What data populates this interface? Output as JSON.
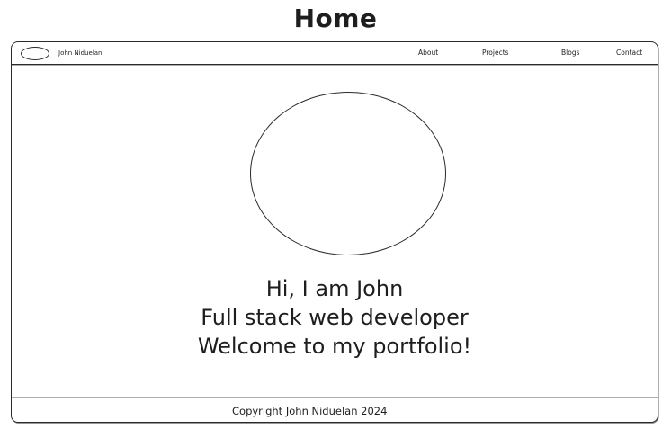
{
  "page": {
    "title": "Home"
  },
  "navbar": {
    "brand_name": "John Niduelan",
    "links": [
      {
        "label": "About"
      },
      {
        "label": "Projects"
      },
      {
        "label": "Blogs"
      },
      {
        "label": "Contact"
      }
    ]
  },
  "hero": {
    "line1": "Hi, I am John",
    "line2": "Full stack web developer",
    "line3": "Welcome to my portfolio!"
  },
  "footer": {
    "copyright": "Copyright John Niduelan 2024"
  },
  "colors": {
    "stroke": "#1e1e1e",
    "background": "#ffffff"
  }
}
